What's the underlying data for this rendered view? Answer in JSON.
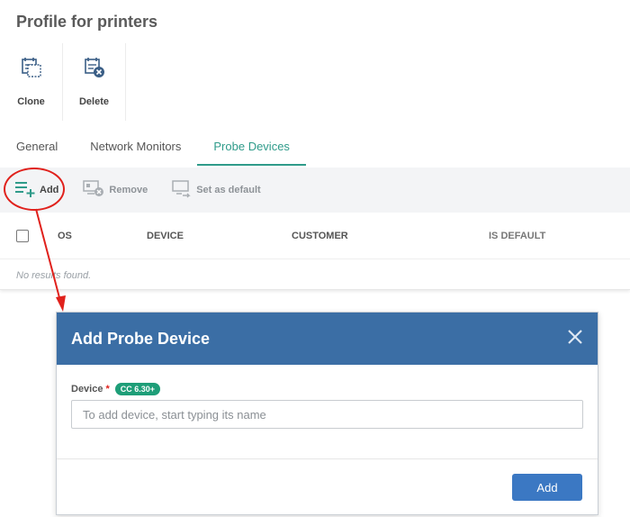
{
  "page": {
    "title": "Profile for printers"
  },
  "actions": [
    {
      "label": "Clone",
      "icon": "clone-icon"
    },
    {
      "label": "Delete",
      "icon": "delete-icon"
    }
  ],
  "tabs": [
    {
      "label": "General",
      "active": false
    },
    {
      "label": "Network Monitors",
      "active": false
    },
    {
      "label": "Probe Devices",
      "active": true
    }
  ],
  "toolbar": {
    "add_label": "Add",
    "remove_label": "Remove",
    "set_default_label": "Set as default"
  },
  "table": {
    "columns": [
      "OS",
      "DEVICE",
      "CUSTOMER",
      "IS DEFAULT"
    ],
    "empty_text": "No results found."
  },
  "modal": {
    "title": "Add Probe Device",
    "device_label": "Device",
    "required_mark": "*",
    "version_badge": "CC 6.30+",
    "device_placeholder": "To add device, start typing its name",
    "add_button_label": "Add"
  },
  "colors": {
    "accent_tab": "#2f9b8a",
    "modal_header": "#3b6ea5",
    "primary_button": "#3b78c3",
    "badge": "#1e9e78",
    "annotation_red": "#e0211c"
  }
}
